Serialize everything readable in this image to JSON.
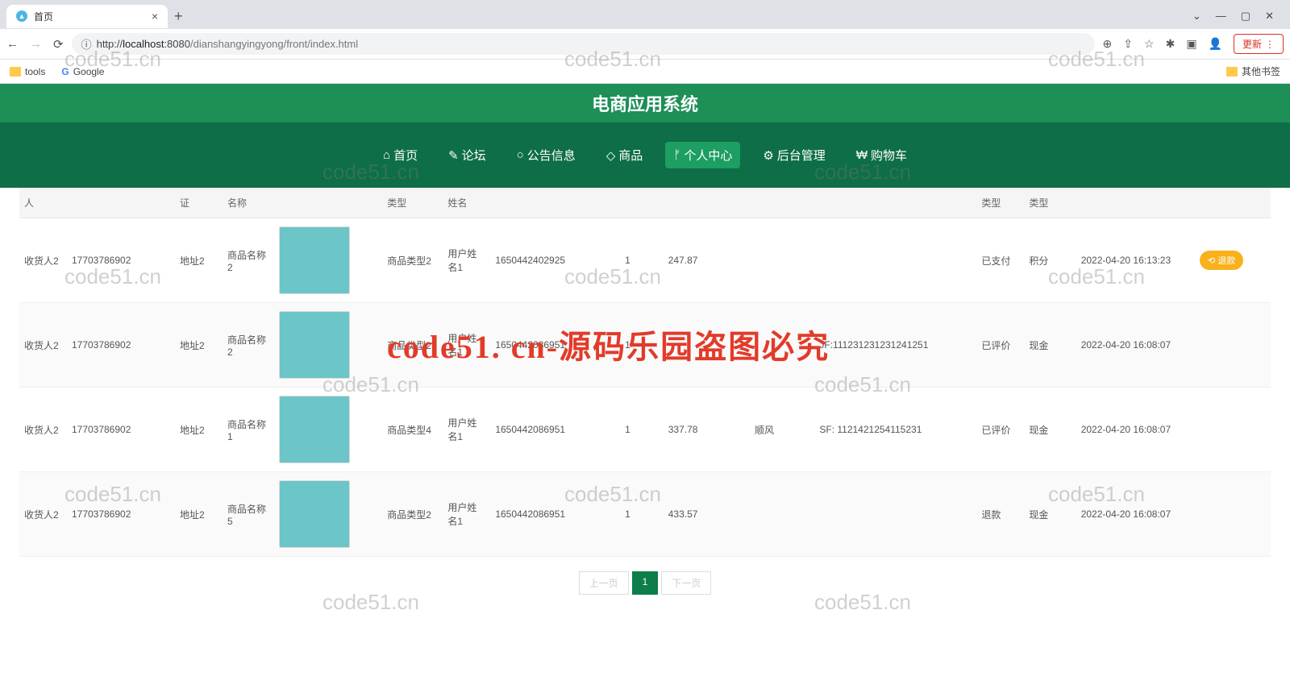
{
  "browser": {
    "tab_title": "首页",
    "url_proto": "http://",
    "url_host": "localhost",
    "url_port": ":8080",
    "url_path": "/dianshangyingyong/front/index.html",
    "update_label": "更新",
    "bookmarks": {
      "tools": "tools",
      "google": "Google",
      "other": "其他书签"
    }
  },
  "site": {
    "title": "电商应用系统",
    "nav": [
      {
        "icon": "⌂",
        "label": "首页"
      },
      {
        "icon": "✎",
        "label": "论坛"
      },
      {
        "icon": "○",
        "label": "公告信息"
      },
      {
        "icon": "◇",
        "label": "商品"
      },
      {
        "icon": "ᚠ",
        "label": "个人中心",
        "active": true
      },
      {
        "icon": "⚙",
        "label": "后台管理"
      },
      {
        "icon": "₩",
        "label": "购物车"
      }
    ]
  },
  "table": {
    "headers": [
      "人",
      "",
      "证",
      "名称",
      "",
      "",
      "类型",
      "姓名",
      "",
      "",
      "",
      "",
      "",
      "",
      "类型",
      "类型",
      "",
      ""
    ],
    "rows": [
      {
        "c": [
          "收货人2",
          "17703786902",
          "地址2",
          "商品名称2",
          "[img]",
          "商品类型2",
          "用户姓名1",
          "1650442402925",
          "1",
          "247.87",
          "",
          "",
          "已支付",
          "积分",
          "2022-04-20 16:13:23"
        ],
        "action": "退款"
      },
      {
        "c": [
          "收货人2",
          "17703786902",
          "地址2",
          "商品名称2",
          "[img]",
          "商品类型2",
          "用户姓名1",
          "1650442086951",
          "1",
          "",
          "",
          "JF:1112312312312412​51",
          "已评价",
          "现金",
          "2022-04-20 16:08:07"
        ],
        "action": ""
      },
      {
        "c": [
          "收货人2",
          "17703786902",
          "地址2",
          "商品名称1",
          "[img]",
          "商品类型4",
          "用户姓名1",
          "1650442086951",
          "1",
          "337.78",
          "顺风",
          "SF: 1121421254115231",
          "已评价",
          "现金",
          "2022-04-20 16:08:07"
        ],
        "action": ""
      },
      {
        "c": [
          "收货人2",
          "17703786902",
          "地址2",
          "商品名称5",
          "[img]",
          "商品类型2",
          "用户姓名1",
          "1650442086951",
          "1",
          "433.57",
          "",
          "",
          "退款",
          "现金",
          "2022-04-20 16:08:07"
        ],
        "action": ""
      }
    ]
  },
  "pagination": {
    "prev": "上一页",
    "current": "1",
    "next": "下一页"
  },
  "watermarks": {
    "small": "code51.cn",
    "big": "code51. cn-源码乐园盗图必究"
  },
  "actions": {
    "refund": "退款"
  }
}
